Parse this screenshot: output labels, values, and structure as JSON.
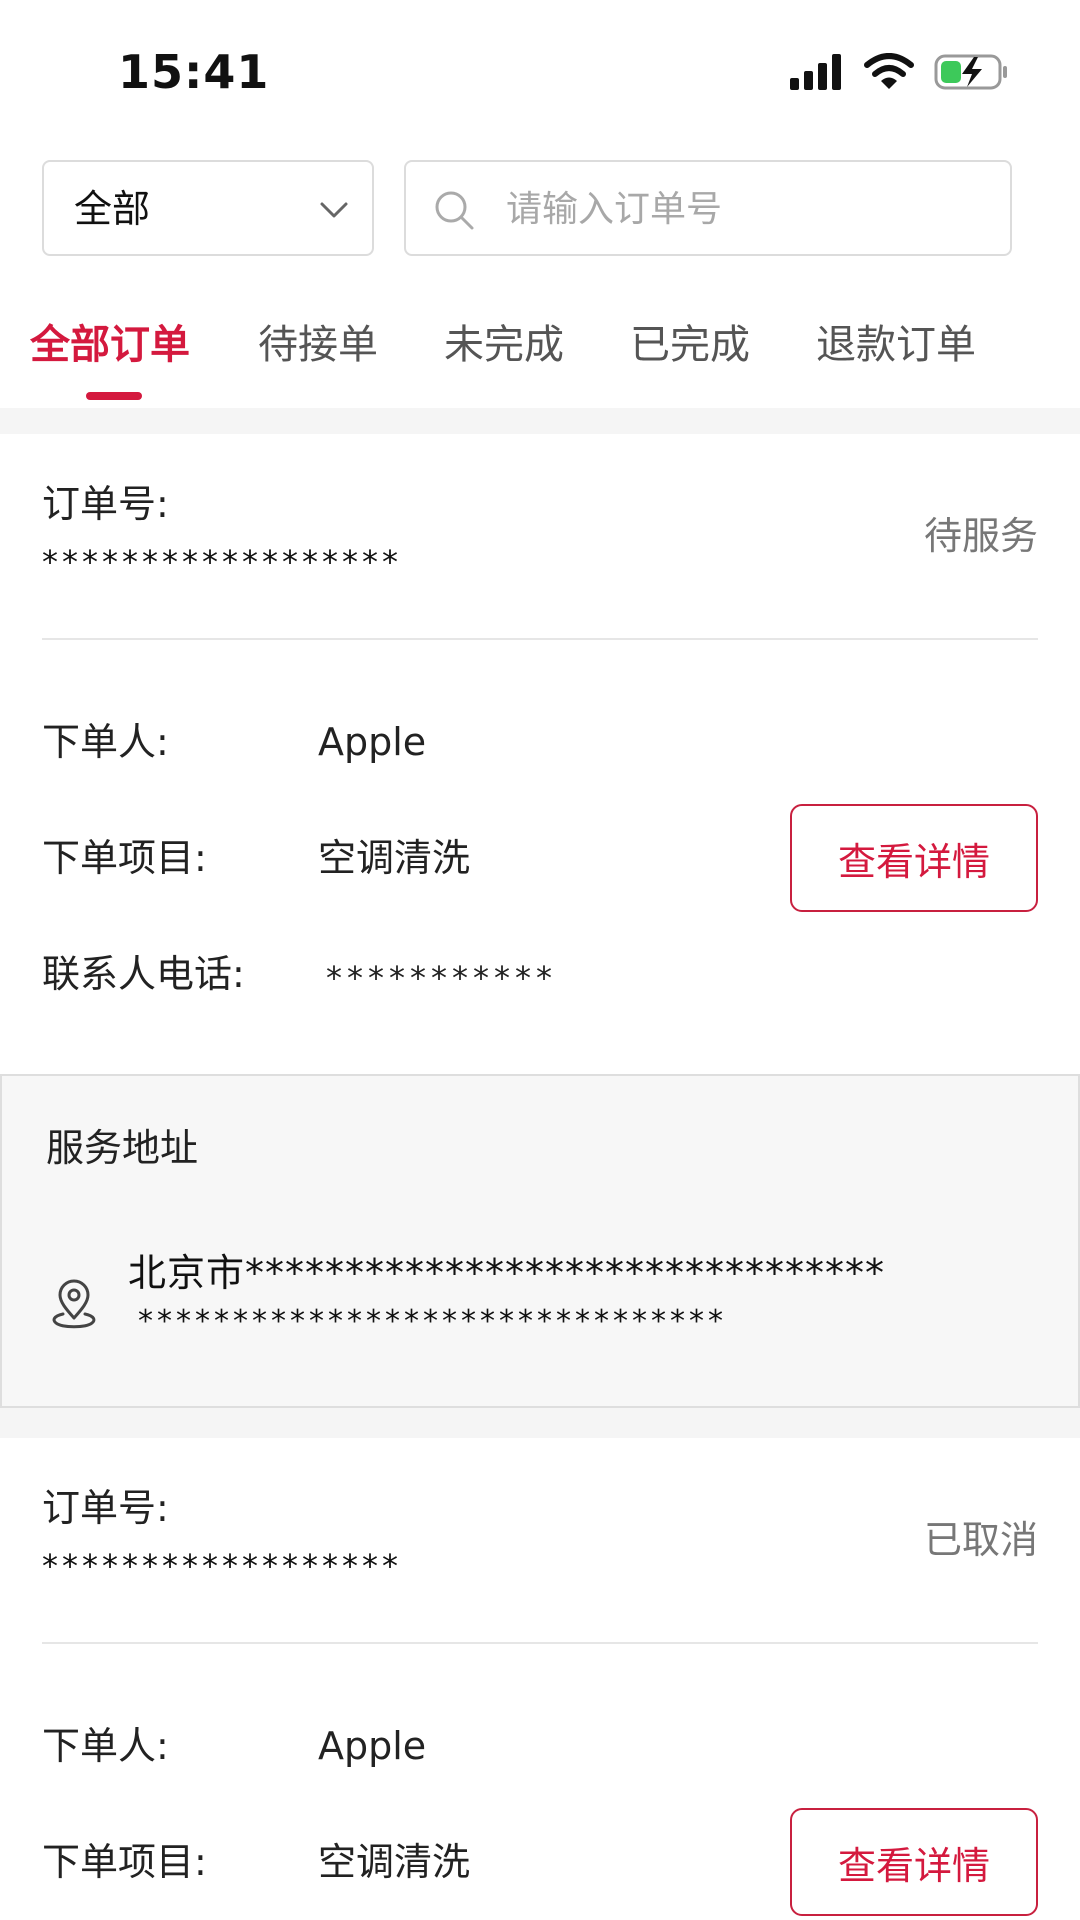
{
  "status_bar": {
    "time": "15:41",
    "icons": [
      "signal-icon",
      "wifi-icon",
      "battery-charging-icon"
    ],
    "battery_color": "#3dc95a"
  },
  "filter": {
    "selected": "全部",
    "search_placeholder": "请输入订单号"
  },
  "tabs": [
    {
      "label": "全部订单",
      "active": true
    },
    {
      "label": "待接单",
      "active": false
    },
    {
      "label": "未完成",
      "active": false
    },
    {
      "label": "已完成",
      "active": false
    },
    {
      "label": "退款订单",
      "active": false
    }
  ],
  "accent_color": "#d4193e",
  "orders": [
    {
      "order_no_label": "订单号:",
      "order_no": "******************",
      "status": "待服务",
      "customer_label": "下单人:",
      "customer": "Apple",
      "item_label": "下单项目:",
      "item": "空调清洗",
      "phone_label": "联系人电话:",
      "phone": "***********",
      "detail_button": "查看详情",
      "address_title": "服务地址",
      "address_line1": "北京市********************************",
      "address_line2": "*******************************"
    },
    {
      "order_no_label": "订单号:",
      "order_no": "******************",
      "status": "已取消",
      "customer_label": "下单人:",
      "customer": "Apple",
      "item_label": "下单项目:",
      "item": "空调清洗",
      "detail_button": "查看详情"
    }
  ]
}
